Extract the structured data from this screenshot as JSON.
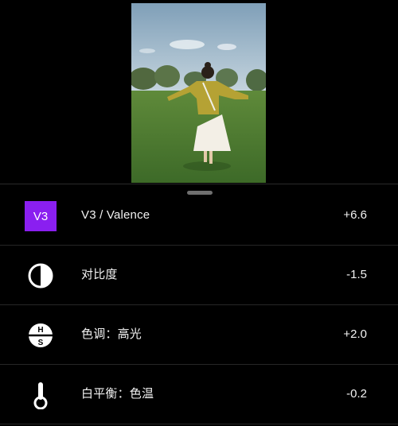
{
  "adjustments": [
    {
      "icon": "v3-preset-badge",
      "badge_text": "V3",
      "label": "V3 / Valence",
      "value": "+6.6"
    },
    {
      "icon": "contrast-icon",
      "label": "对比度",
      "value": "-1.5"
    },
    {
      "icon": "hs-tone-icon",
      "icon_letters": [
        "H",
        "S"
      ],
      "label": "色调：高光",
      "value": "+2.0"
    },
    {
      "icon": "thermometer-icon",
      "label": "白平衡：色温",
      "value": "-0.2"
    }
  ],
  "colors": {
    "background": "#000000",
    "accent_badge": "#8a1ff0",
    "text": "#f2f2f2"
  }
}
